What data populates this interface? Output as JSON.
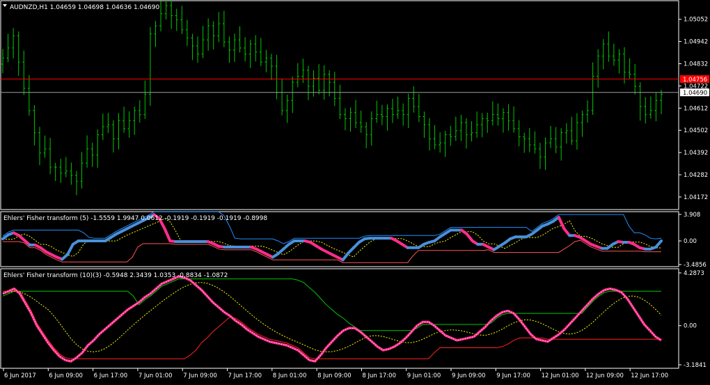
{
  "colors": {
    "background": "#000000",
    "frame": "#ffffff",
    "bar": "#00c800",
    "bid_line": "#a0a0a0",
    "ask_line": "#ff0000",
    "ask_label": "#ff0000",
    "fisher_up": "#4a90d9",
    "fisher_down": "#ff2d8c",
    "signal_dots": "#ffff00",
    "channel_upper": "#1e90ff",
    "channel_lower": "#ff5555",
    "panel3_dashed": "#ffff00",
    "panel3_green": "#00c800",
    "panel3_red": "#ff2222",
    "panel3_main": "#ff2d8c"
  },
  "main_chart": {
    "header_icon": "dropdown-triangle-icon",
    "header": "AUDNZD,H1  1.04659 1.04698 1.04636 1.04690",
    "price_ticks": [
      "1.05052",
      "1.04942",
      "1.04832",
      "1.04722",
      "1.04612",
      "1.04502",
      "1.04392",
      "1.04282",
      "1.04172"
    ],
    "ask_price_label": "1.04756",
    "bid_price_label": "1.04690"
  },
  "panel1": {
    "title": "Ehlers' Fisher transform (5) -1.5559 1.9947 0.0612 -0.1919 -0.1919 -0.1919 -0.8998",
    "ticks": [
      "3.908",
      "0.00",
      "-3.4856"
    ]
  },
  "panel2": {
    "title": "Ehlers' Fisher transform (10)(3) -0.5948 2.3439 1.0353 -0.8834 -1.0872",
    "ticks": [
      "4.2873",
      "0.00",
      "-3.1841"
    ]
  },
  "time_axis": [
    "6 Jun 2017",
    "6 Jun 09:00",
    "6 Jun 17:00",
    "7 Jun 01:00",
    "7 Jun 09:00",
    "7 Jun 17:00",
    "8 Jun 01:00",
    "8 Jun 09:00",
    "8 Jun 17:00",
    "9 Jun 01:00",
    "9 Jun 09:00",
    "9 Jun 17:00",
    "12 Jun 01:00",
    "12 Jun 09:00",
    "12 Jun 17:00"
  ],
  "chart_data": [
    {
      "type": "ohlc",
      "title": "AUDNZD,H1  1.04659 1.04698 1.04636 1.04690",
      "ylim": [
        1.0412,
        1.0512
      ],
      "x": [
        "6 Jun 2017",
        "6 Jun 09:00",
        "6 Jun 17:00",
        "7 Jun 01:00",
        "7 Jun 09:00",
        "7 Jun 17:00",
        "8 Jun 01:00",
        "8 Jun 09:00",
        "8 Jun 17:00",
        "9 Jun 01:00",
        "9 Jun 09:00",
        "9 Jun 17:00",
        "12 Jun 01:00",
        "12 Jun 09:00",
        "12 Jun 17:00"
      ],
      "close": [
        1.0486,
        1.0491,
        1.0497,
        1.0484,
        1.0471,
        1.046,
        1.0449,
        1.0439,
        1.0441,
        1.0432,
        1.0432,
        1.0429,
        1.043,
        1.0428,
        1.0425,
        1.0434,
        1.0441,
        1.0438,
        1.0448,
        1.0452,
        1.0453,
        1.0446,
        1.0455,
        1.0451,
        1.0455,
        1.046,
        1.0458,
        1.0468,
        1.0498,
        1.0502,
        1.0508,
        1.0512,
        1.0507,
        1.0505,
        1.05,
        1.0496,
        1.0492,
        1.0488,
        1.0495,
        1.0502,
        1.0497,
        1.0503,
        1.0494,
        1.049,
        1.0495,
        1.0491,
        1.0488,
        1.0493,
        1.0489,
        1.0484,
        1.0486,
        1.0482,
        1.0469,
        1.046,
        1.0465,
        1.0474,
        1.0477,
        1.048,
        1.0472,
        1.0476,
        1.047,
        1.0478,
        1.0474,
        1.0466,
        1.0458,
        1.0456,
        1.0459,
        1.0454,
        1.0452,
        1.0448,
        1.0456,
        1.0458,
        1.0457,
        1.0461,
        1.0458,
        1.046,
        1.0458,
        1.0466,
        1.0462,
        1.0457,
        1.0453,
        1.0446,
        1.0443,
        1.0444,
        1.0448,
        1.0447,
        1.045,
        1.0454,
        1.0448,
        1.0449,
        1.0453,
        1.0456,
        1.0455,
        1.0458,
        1.0456,
        1.0459,
        1.0455,
        1.0451,
        1.0447,
        1.0446,
        1.0443,
        1.0441,
        1.0437,
        1.0444,
        1.0446,
        1.0442,
        1.0449,
        1.045,
        1.0445,
        1.0454,
        1.0458,
        1.046,
        1.0477,
        1.0487,
        1.0493,
        1.0487,
        1.0485,
        1.0488,
        1.0479,
        1.0478,
        1.0472,
        1.0462,
        1.0458,
        1.046,
        1.0465,
        1.0468
      ],
      "series": [
        {
          "name": "Bid",
          "value": 1.0469
        },
        {
          "name": "Ask",
          "value": 1.04756
        }
      ]
    },
    {
      "type": "line",
      "title": "Ehlers' Fisher transform (5) -1.5559 1.9947 0.0612 -0.1919 -0.1919 -0.1919 -0.8998",
      "ylim": [
        -3.4856,
        3.908
      ],
      "fisher": [
        0.3,
        0.9,
        1.2,
        0.8,
        0.1,
        -0.6,
        -0.6,
        -1.0,
        -1.6,
        -2.0,
        -2.4,
        -2.7,
        -2.0,
        -0.5,
        0.0,
        0.0,
        0.0,
        0.0,
        0.0,
        0.0,
        0.5,
        1.0,
        1.4,
        1.8,
        2.2,
        2.6,
        3.0,
        3.4,
        3.9,
        3.3,
        1.8,
        0.0,
        -0.1,
        -0.1,
        -0.1,
        -0.1,
        -0.1,
        -0.1,
        -0.1,
        -0.4,
        -0.8,
        -0.9,
        -0.9,
        -0.9,
        -0.9,
        -0.9,
        -0.9,
        -1.2,
        -1.6,
        -2.0,
        -2.4,
        -1.9,
        -1.2,
        -0.5,
        0.0,
        0.0,
        0.0,
        -0.2,
        -0.7,
        -1.2,
        -1.6,
        -2.0,
        -2.4,
        -2.8,
        -1.8,
        -1.0,
        -0.2,
        0.3,
        0.4,
        0.4,
        0.4,
        0.4,
        0.4,
        0.0,
        -0.5,
        -1.0,
        -1.0,
        -1.0,
        -0.5,
        -0.2,
        0.0,
        0.6,
        1.1,
        1.6,
        1.6,
        1.6,
        1.0,
        0.0,
        -0.5,
        -0.5,
        -0.9,
        -1.3,
        -0.8,
        -0.3,
        0.3,
        0.6,
        0.6,
        0.6,
        1.0,
        1.6,
        2.2,
        2.5,
        2.9,
        3.5,
        1.8,
        0.8,
        0.8,
        0.5,
        0.0,
        -0.5,
        -0.8,
        -1.1,
        -1.1,
        -0.5,
        -0.1,
        -0.2,
        -0.2,
        -0.5,
        -1.0,
        -1.2,
        -1.2,
        -0.9,
        0.0
      ],
      "series": [
        {
          "name": "upper",
          "role": "channel"
        },
        {
          "name": "lower",
          "role": "channel"
        },
        {
          "name": "signal",
          "role": "dotted"
        }
      ]
    },
    {
      "type": "line",
      "title": "Ehlers' Fisher transform (10)(3) -0.5948 2.3439 1.0353 -0.8834 -1.0872",
      "ylim": [
        -3.1841,
        4.2873
      ],
      "fisher": [
        2.6,
        2.8,
        3.0,
        2.6,
        1.8,
        1.0,
        0.0,
        -0.7,
        -1.4,
        -2.0,
        -2.5,
        -2.8,
        -2.9,
        -2.6,
        -2.2,
        -1.6,
        -1.2,
        -0.7,
        -0.3,
        0.1,
        0.5,
        0.9,
        1.3,
        1.6,
        1.9,
        2.3,
        2.6,
        3.0,
        3.4,
        3.6,
        3.8,
        4.0,
        3.9,
        3.7,
        3.3,
        2.9,
        2.4,
        1.9,
        1.5,
        1.1,
        0.8,
        0.4,
        0.1,
        -0.3,
        -0.6,
        -0.9,
        -1.1,
        -1.3,
        -1.4,
        -1.5,
        -1.6,
        -1.8,
        -2.0,
        -2.4,
        -2.8,
        -2.9,
        -2.4,
        -1.8,
        -1.3,
        -0.8,
        -0.4,
        -0.2,
        -0.2,
        -0.5,
        -0.9,
        -1.3,
        -1.7,
        -2.0,
        -1.9,
        -1.7,
        -1.4,
        -1.0,
        -0.5,
        0.0,
        0.3,
        0.3,
        0.0,
        -0.4,
        -0.8,
        -1.0,
        -1.2,
        -1.1,
        -1.0,
        -0.9,
        -0.5,
        -0.1,
        0.4,
        0.8,
        1.1,
        1.2,
        1.0,
        0.5,
        -0.1,
        -0.7,
        -1.1,
        -1.2,
        -1.3,
        -1.0,
        -0.7,
        -0.3,
        0.2,
        0.7,
        1.2,
        1.7,
        2.2,
        2.6,
        2.9,
        3.0,
        2.9,
        2.7,
        2.2,
        1.5,
        0.8,
        0.1,
        -0.4,
        -0.9,
        -1.2
      ]
    }
  ]
}
